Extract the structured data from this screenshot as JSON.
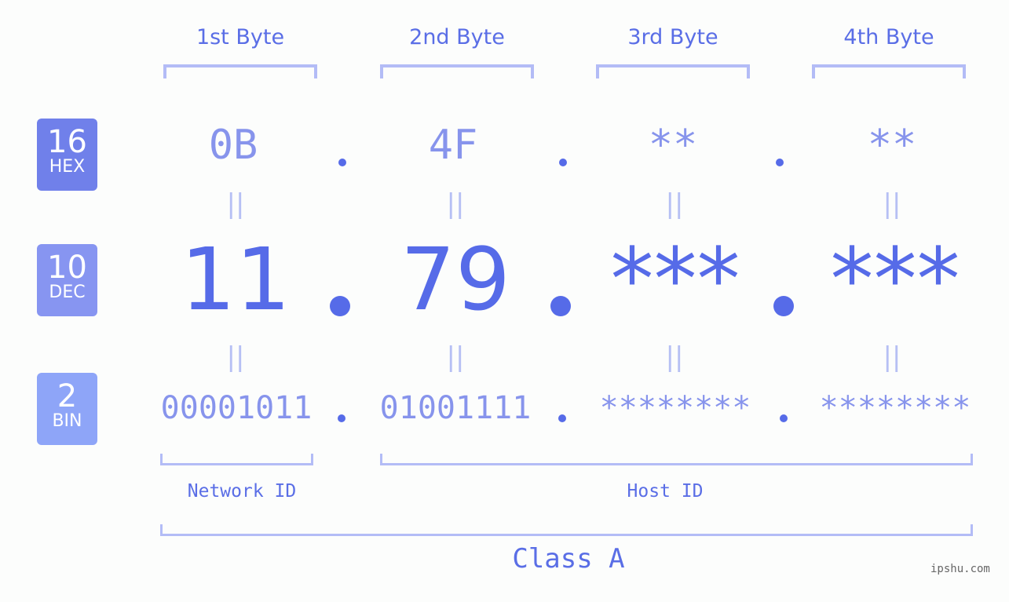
{
  "bytes": [
    {
      "title": "1st Byte",
      "hex": "0B",
      "dec": "11",
      "bin": "00001011"
    },
    {
      "title": "2nd Byte",
      "hex": "4F",
      "dec": "79",
      "bin": "01001111"
    },
    {
      "title": "3rd Byte",
      "hex": "**",
      "dec": "***",
      "bin": "********"
    },
    {
      "title": "4th Byte",
      "hex": "**",
      "dec": "***",
      "bin": "********"
    }
  ],
  "bases": {
    "hex": {
      "num": "16",
      "label": "HEX"
    },
    "dec": {
      "num": "10",
      "label": "DEC"
    },
    "bin": {
      "num": "2",
      "label": "BIN"
    }
  },
  "equals": "||",
  "network_label": "Network ID",
  "host_label": "Host ID",
  "class_label": "Class A",
  "watermark": "ipshu.com",
  "colors": {
    "accent": "#566be8",
    "light": "#b3bcf6",
    "hex_badge": "#7080ea",
    "dec_badge": "#8795f1",
    "bin_badge": "#8ea5f8"
  }
}
